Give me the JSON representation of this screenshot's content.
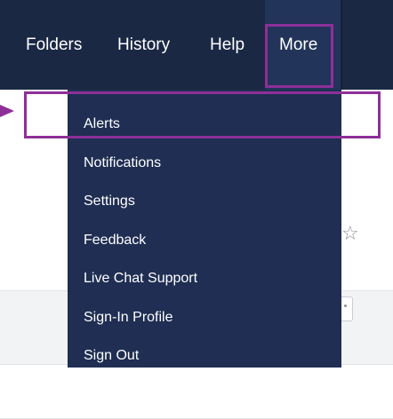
{
  "nav": {
    "items": [
      {
        "label": "Folders"
      },
      {
        "label": "History"
      },
      {
        "label": "Help"
      },
      {
        "label": "More"
      }
    ]
  },
  "dropdown": {
    "items": [
      {
        "label": "Alerts"
      },
      {
        "label": "Notifications"
      },
      {
        "label": "Settings"
      },
      {
        "label": "Feedback"
      },
      {
        "label": "Live Chat Support"
      },
      {
        "label": "Sign-In Profile"
      },
      {
        "label": "Sign Out"
      }
    ]
  },
  "colors": {
    "navbar_bg": "#1a2844",
    "more_active_bg": "#22345a",
    "dropdown_bg": "#1f2e52",
    "annotation": "#8e2f98",
    "text": "#ffffff"
  },
  "icons": {
    "row_action_1": "star-outline-icon",
    "row_action_2": "share-icon",
    "annotation_pointer": "arrow-pointer-icon"
  }
}
